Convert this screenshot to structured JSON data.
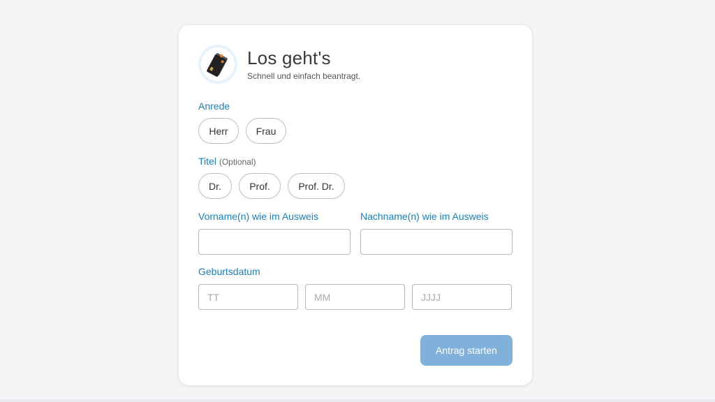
{
  "header": {
    "title": "Los geht's",
    "subtitle": "Schnell und einfach beantragt.",
    "logo_icon": "credit-card-icon"
  },
  "salutation": {
    "label": "Anrede",
    "options": [
      "Herr",
      "Frau"
    ]
  },
  "title_field": {
    "label": "Titel",
    "optional": "(Optional)",
    "options": [
      "Dr.",
      "Prof.",
      "Prof. Dr."
    ]
  },
  "first_name": {
    "label": "Vorname(n) wie im Ausweis",
    "value": "",
    "placeholder": ""
  },
  "last_name": {
    "label": "Nachname(n) wie im Ausweis",
    "value": "",
    "placeholder": ""
  },
  "birthdate": {
    "label": "Geburtsdatum",
    "day_placeholder": "TT",
    "month_placeholder": "MM",
    "year_placeholder": "JJJJ"
  },
  "submit": {
    "label": "Antrag starten"
  },
  "colors": {
    "accent": "#1b7fbf",
    "button": "#7fb1da",
    "background": "#f4f5f7"
  }
}
